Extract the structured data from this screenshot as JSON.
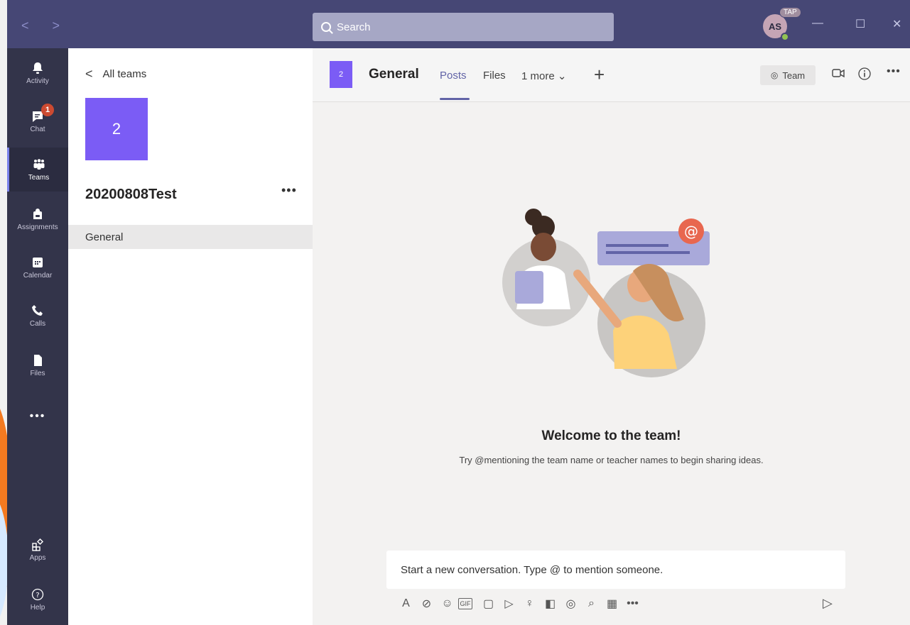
{
  "window": {
    "nav_arrows": "<  >",
    "search_placeholder": "Search",
    "avatar_initials": "AS",
    "avatar_badge": "TAP",
    "minimize": "—",
    "maximize": "☐",
    "close": "✕"
  },
  "rail": {
    "items": [
      {
        "label": "Activity",
        "icon": "bell-icon"
      },
      {
        "label": "Chat",
        "icon": "chat-icon",
        "badge": "1"
      },
      {
        "label": "Teams",
        "icon": "teams-icon",
        "active": true
      },
      {
        "label": "Assignments",
        "icon": "backpack-icon"
      },
      {
        "label": "Calendar",
        "icon": "calendar-icon"
      },
      {
        "label": "Calls",
        "icon": "phone-icon"
      },
      {
        "label": "Files",
        "icon": "file-icon"
      }
    ],
    "more": "•••",
    "apps": "Apps",
    "help": "Help"
  },
  "panel": {
    "back_label": "All teams",
    "team_tile": "2",
    "team_name": "20200808Test",
    "team_more": "•••",
    "channels": [
      "General"
    ]
  },
  "header": {
    "tile": "2",
    "channel": "General",
    "tabs": [
      "Posts",
      "Files",
      "1 more"
    ],
    "team_button": "Team"
  },
  "content": {
    "welcome_title": "Welcome to the team!",
    "welcome_subtitle": "Try @mentioning the team name or teacher names to begin sharing ideas.",
    "compose_placeholder": "Start a new conversation. Type @ to mention someone."
  },
  "colors": {
    "titlebar": "#464775",
    "rail": "#33344a",
    "accent": "#6264a7",
    "team_tile": "#7b5cf5",
    "badge": "#cc4a31"
  }
}
